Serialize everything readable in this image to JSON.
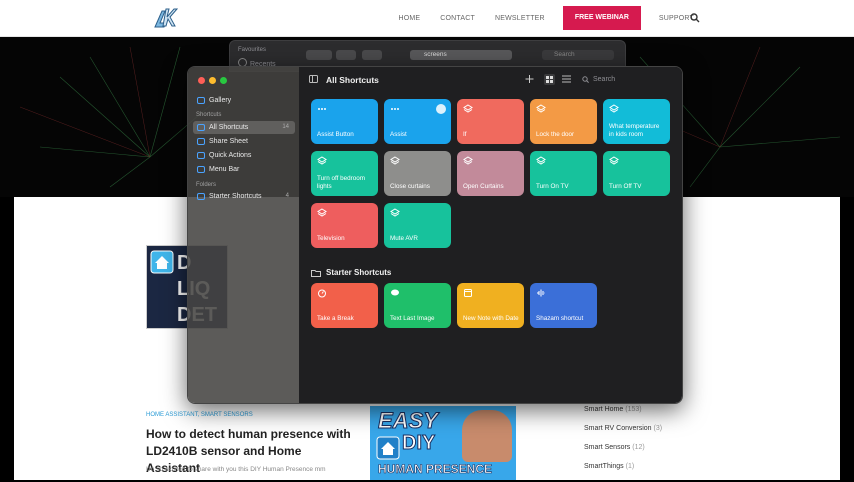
{
  "site": {
    "nav": [
      "HOME",
      "CONTACT",
      "NEWSLETTER"
    ],
    "cta": "FREE WEBINAR",
    "support": "SUPPORT",
    "colors": {
      "cta": "#d61a4f",
      "accent": "#2a9bd6"
    }
  },
  "article": {
    "thumb1_text": "D\nLIQ\nDET",
    "categories": "HOME ASSISTANT, SMART SENSORS",
    "title": "How to detect human presence with LD2410B sensor and Home Assistant",
    "excerpt": "I'm so excited to share with you this DIY Human Presence mm",
    "thumb2": {
      "line1": "EASY",
      "line2": "DIY",
      "line3": "HUMAN PRESENCE"
    }
  },
  "sidebar_links": [
    {
      "name": "Smart Home",
      "count": "(153)"
    },
    {
      "name": "Smart RV Conversion",
      "count": "(3)"
    },
    {
      "name": "Smart Sensors",
      "count": "(12)"
    },
    {
      "name": "SmartThings",
      "count": "(1)"
    }
  ],
  "finder": {
    "sidebar_header": "Favourites",
    "sidebar_item": "Recents",
    "path": "screens",
    "search_placeholder": "Search"
  },
  "shortcuts": {
    "sidebar": {
      "gallery": "Gallery",
      "section_shortcuts": "Shortcuts",
      "items": [
        {
          "label": "All Shortcuts",
          "count": "14"
        },
        {
          "label": "Share Sheet",
          "count": ""
        },
        {
          "label": "Quick Actions",
          "count": ""
        },
        {
          "label": "Menu Bar",
          "count": ""
        }
      ],
      "section_folders": "Folders",
      "folder": {
        "label": "Starter Shortcuts",
        "count": "4"
      }
    },
    "toolbar": {
      "title": "All Shortcuts",
      "search_placeholder": "Search"
    },
    "tiles": [
      {
        "label": "Assist Button",
        "color": "#1aa3ec",
        "icon": "dots-icon"
      },
      {
        "label": "Assist",
        "color": "#1aa3ec",
        "icon": "dots-icon"
      },
      {
        "label": "If",
        "color": "#f06a5e",
        "icon": "layers-icon"
      },
      {
        "label": "Lock the door",
        "color": "#f39a45",
        "icon": "layers-icon"
      },
      {
        "label": "What temperature in kids room",
        "color": "#12bcd8",
        "icon": "layers-icon"
      },
      {
        "label": "Turn off bedroom lights",
        "color": "#17c29c",
        "icon": "layers-icon"
      },
      {
        "label": "Close curtains",
        "color": "#8e8e8c",
        "icon": "layers-icon"
      },
      {
        "label": "Open Curtains",
        "color": "#c28a9a",
        "icon": "layers-icon"
      },
      {
        "label": "Turn On TV",
        "color": "#17c29c",
        "icon": "layers-icon"
      },
      {
        "label": "Turn Off TV",
        "color": "#17c29c",
        "icon": "layers-icon"
      },
      {
        "label": "Television",
        "color": "#ee5e5e",
        "icon": "layers-icon"
      },
      {
        "label": "Mute AVR",
        "color": "#17c29c",
        "icon": "layers-icon"
      }
    ],
    "starter_title": "Starter Shortcuts",
    "starter_tiles": [
      {
        "label": "Take a Break",
        "color": "#f2604a",
        "icon": "timer-icon"
      },
      {
        "label": "Text Last Image",
        "color": "#1fbf6a",
        "icon": "message-icon"
      },
      {
        "label": "New Note with Date",
        "color": "#f0b020",
        "icon": "note-icon"
      },
      {
        "label": "Shazam shortcut",
        "color": "#3b6fd8",
        "icon": "shazam-icon"
      }
    ]
  }
}
